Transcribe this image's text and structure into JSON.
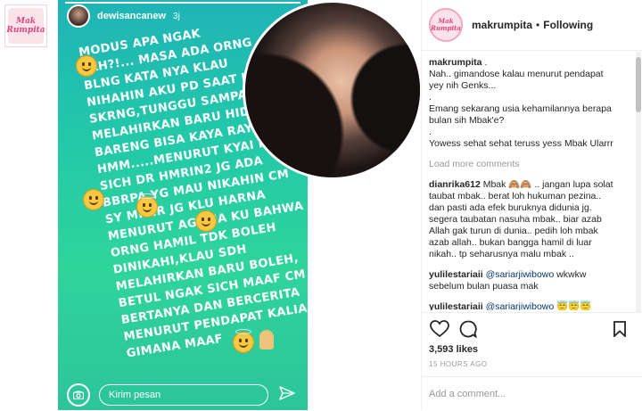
{
  "left_logo": {
    "line1": "Mak",
    "line2": "Rumpita"
  },
  "story": {
    "username": "dewisancanew",
    "time": "3j",
    "progress": 1.0,
    "text_lines": [
      "MODUS APA NGAK",
      "YAH?!... MASA ADA ORNG",
      "BLNG KATA NYA KLAU",
      "NIHAHIN AKU PD SAAT HAMIL",
      "SKRNG,TUNGGU SAMPAI",
      "MELAHIRKAN BARU HIDUP",
      "BARENG BISA KAYA RAYA",
      "HMM.....MENURUT KYAI NYA",
      "SICH DR HMRIN2 JG ADA",
      "BBRPA YG MAU NIKAHIN CM",
      "SY MIKIR JG KLU HARNA",
      "MENURUT AGAMA KU BAHWA",
      "ORNG HAMIL TDK BOLEH",
      "DINIKAHI,KLAU SDH",
      "MELAHIRKAN BARU BOLEH,",
      "BETUL NGAK SICH MAAF CM",
      "BERTANYA DAN BERCERITA",
      "MENURUT PENDAPAT KALIAN",
      "GIMANA MAAF"
    ],
    "reply_placeholder": "Kirim pesan",
    "colors": {
      "top": "#1fb4b7",
      "bottom": "#2cc59a"
    }
  },
  "post": {
    "avatar": {
      "line1": "Mak",
      "line2": "Rumpita"
    },
    "username": "makrumpita",
    "separator": "•",
    "following": "Following",
    "caption_user": "makrumpita",
    "caption_suffix": " .",
    "caption_lines": [
      "Nah.. gimandose kalau menurut pendapat",
      "yey nih Genks...",
      ".",
      "Emang sekarang usia kehamilannya berapa",
      "bulan sih Mbak'e?",
      ".",
      "Yowess sehat sehat teruss yess Mbak Ularrr"
    ],
    "load_more": "Load more comments",
    "comments": [
      {
        "user": "dianrika612",
        "lines": [
          " Mbak 🙈🙈 .. jangan lupa solat",
          "taubat mbak.. berat loh hukuman pezina..",
          "dan pasti ada efek buruknya didunia jg.",
          "segera taubatan nasuha mbak.. biar azab",
          "Allah gak turun di dunia.. pedih loh mbak",
          "azab allah.. bukan bangga hamil di luar",
          "nikah.. tp seharusnya malu mbak .."
        ]
      },
      {
        "user": "yulilestariaii",
        "mention": "@sariarjiwibowo",
        "text": " wkwkw",
        "line2": "sebelum bulan puasa mak"
      },
      {
        "user": "yulilestariaii",
        "mention": "@sariarjiwibowo",
        "text": " 😇😇😇"
      }
    ],
    "likes": "3,593 likes",
    "time_ago": "15 HOURS AGO",
    "add_comment_placeholder": "Add a comment..."
  },
  "icons": [
    "camera-icon",
    "send-icon",
    "heart-icon",
    "comment-icon",
    "bookmark-icon",
    "wink-emoji",
    "grin-emoji",
    "halo-emoji",
    "smirk-emoji",
    "pray-emoji"
  ]
}
